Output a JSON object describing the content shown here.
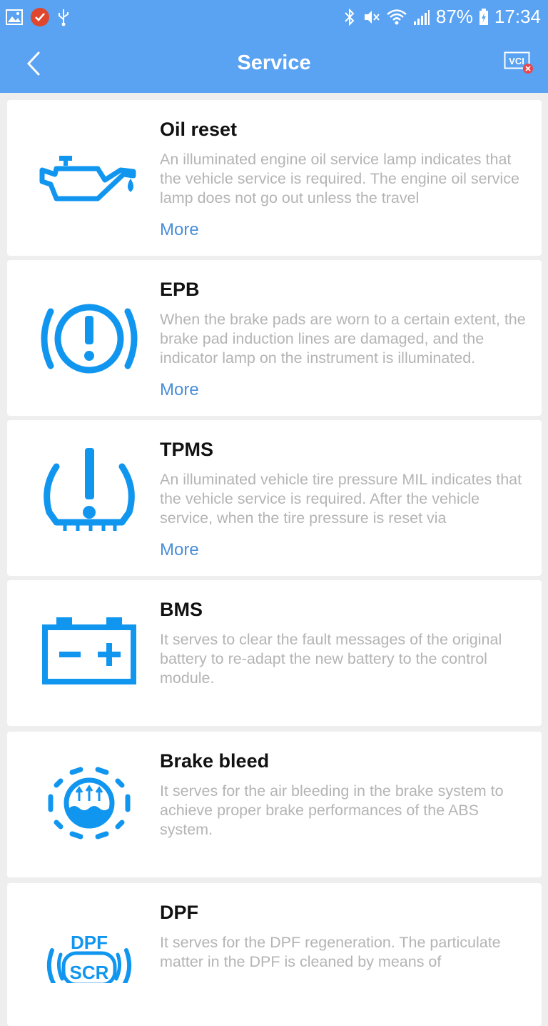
{
  "status_bar": {
    "battery": "87%",
    "time": "17:34",
    "icons": [
      "gallery-icon",
      "notification-badge-icon",
      "usb-icon",
      "bluetooth-icon",
      "mute-icon",
      "wifi-icon",
      "signal-icon",
      "battery-icon"
    ]
  },
  "app_bar": {
    "title": "Service",
    "back_icon": "chevron-left-icon",
    "vci_label": "VCI"
  },
  "colors": {
    "accent": "#5aa2f2",
    "icon_blue": "#1196f0",
    "link": "#4a8fd8",
    "desc": "#b4b4b4"
  },
  "services": [
    {
      "name": "Oil reset",
      "icon": "oil-can-icon",
      "description": "An illuminated engine oil service lamp indicates that the vehicle service is required. The engine oil service lamp does not go out unless the travel",
      "more": "More"
    },
    {
      "name": "EPB",
      "icon": "parking-brake-icon",
      "description": "When the brake pads are worn to a certain extent, the brake pad induction lines are damaged, and the indicator lamp on the instrument is illuminated.",
      "more": "More"
    },
    {
      "name": "TPMS",
      "icon": "tire-pressure-icon",
      "description": "An illuminated vehicle tire pressure MIL indicates that the vehicle service is required. After the vehicle service, when the tire pressure is reset via",
      "more": "More"
    },
    {
      "name": "BMS",
      "icon": "battery-icon",
      "description": "It serves to clear the fault messages of the original battery to re-adapt the new battery to the control module.",
      "more": ""
    },
    {
      "name": "Brake bleed",
      "icon": "brake-fluid-icon",
      "description": "It serves for the air bleeding in the brake system to achieve proper brake performances of the ABS system.",
      "more": ""
    },
    {
      "name": "DPF",
      "icon": "dpf-icon",
      "icon_text_top": "DPF",
      "icon_text_bottom": "SCR",
      "description": "It serves for the DPF regeneration. The particulate matter in the DPF is cleaned by means of",
      "more": ""
    }
  ]
}
